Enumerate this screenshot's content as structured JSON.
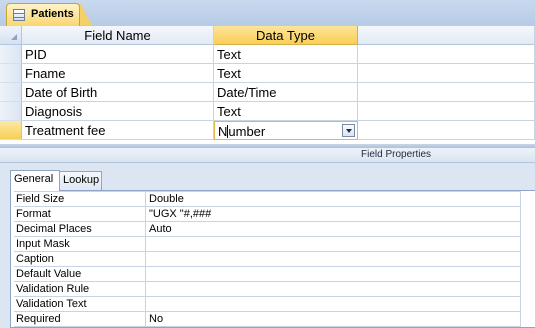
{
  "document_tab": {
    "label": "Patients"
  },
  "grid": {
    "headers": {
      "field_name": "Field Name",
      "data_type": "Data Type",
      "description": ""
    },
    "rows": [
      {
        "field_name": "PID",
        "data_type": "Text",
        "description": ""
      },
      {
        "field_name": "Fname",
        "data_type": "Text",
        "description": ""
      },
      {
        "field_name": "Date of Birth",
        "data_type": "Date/Time",
        "description": ""
      },
      {
        "field_name": "Diagnosis",
        "data_type": "Text",
        "description": ""
      },
      {
        "field_name": "Treatment fee",
        "data_type_prefix": "N",
        "data_type_suffix": "umber",
        "description": ""
      },
      {
        "field_name": "",
        "data_type": "",
        "description": ""
      }
    ]
  },
  "field_properties": {
    "title": "Field Properties",
    "tabs": {
      "general": "General",
      "lookup": "Lookup"
    },
    "rows": [
      {
        "label": "Field Size",
        "value": "Double"
      },
      {
        "label": "Format",
        "value": "\"UGX \"#,###"
      },
      {
        "label": "Decimal Places",
        "value": "Auto"
      },
      {
        "label": "Input Mask",
        "value": ""
      },
      {
        "label": "Caption",
        "value": ""
      },
      {
        "label": "Default Value",
        "value": ""
      },
      {
        "label": "Validation Rule",
        "value": ""
      },
      {
        "label": "Validation Text",
        "value": ""
      },
      {
        "label": "Required",
        "value": "No"
      }
    ]
  },
  "colors": {
    "active_header": "#f9cf54",
    "tab_strip": "#b7cbe6",
    "properties_background": "#dce6f2"
  }
}
